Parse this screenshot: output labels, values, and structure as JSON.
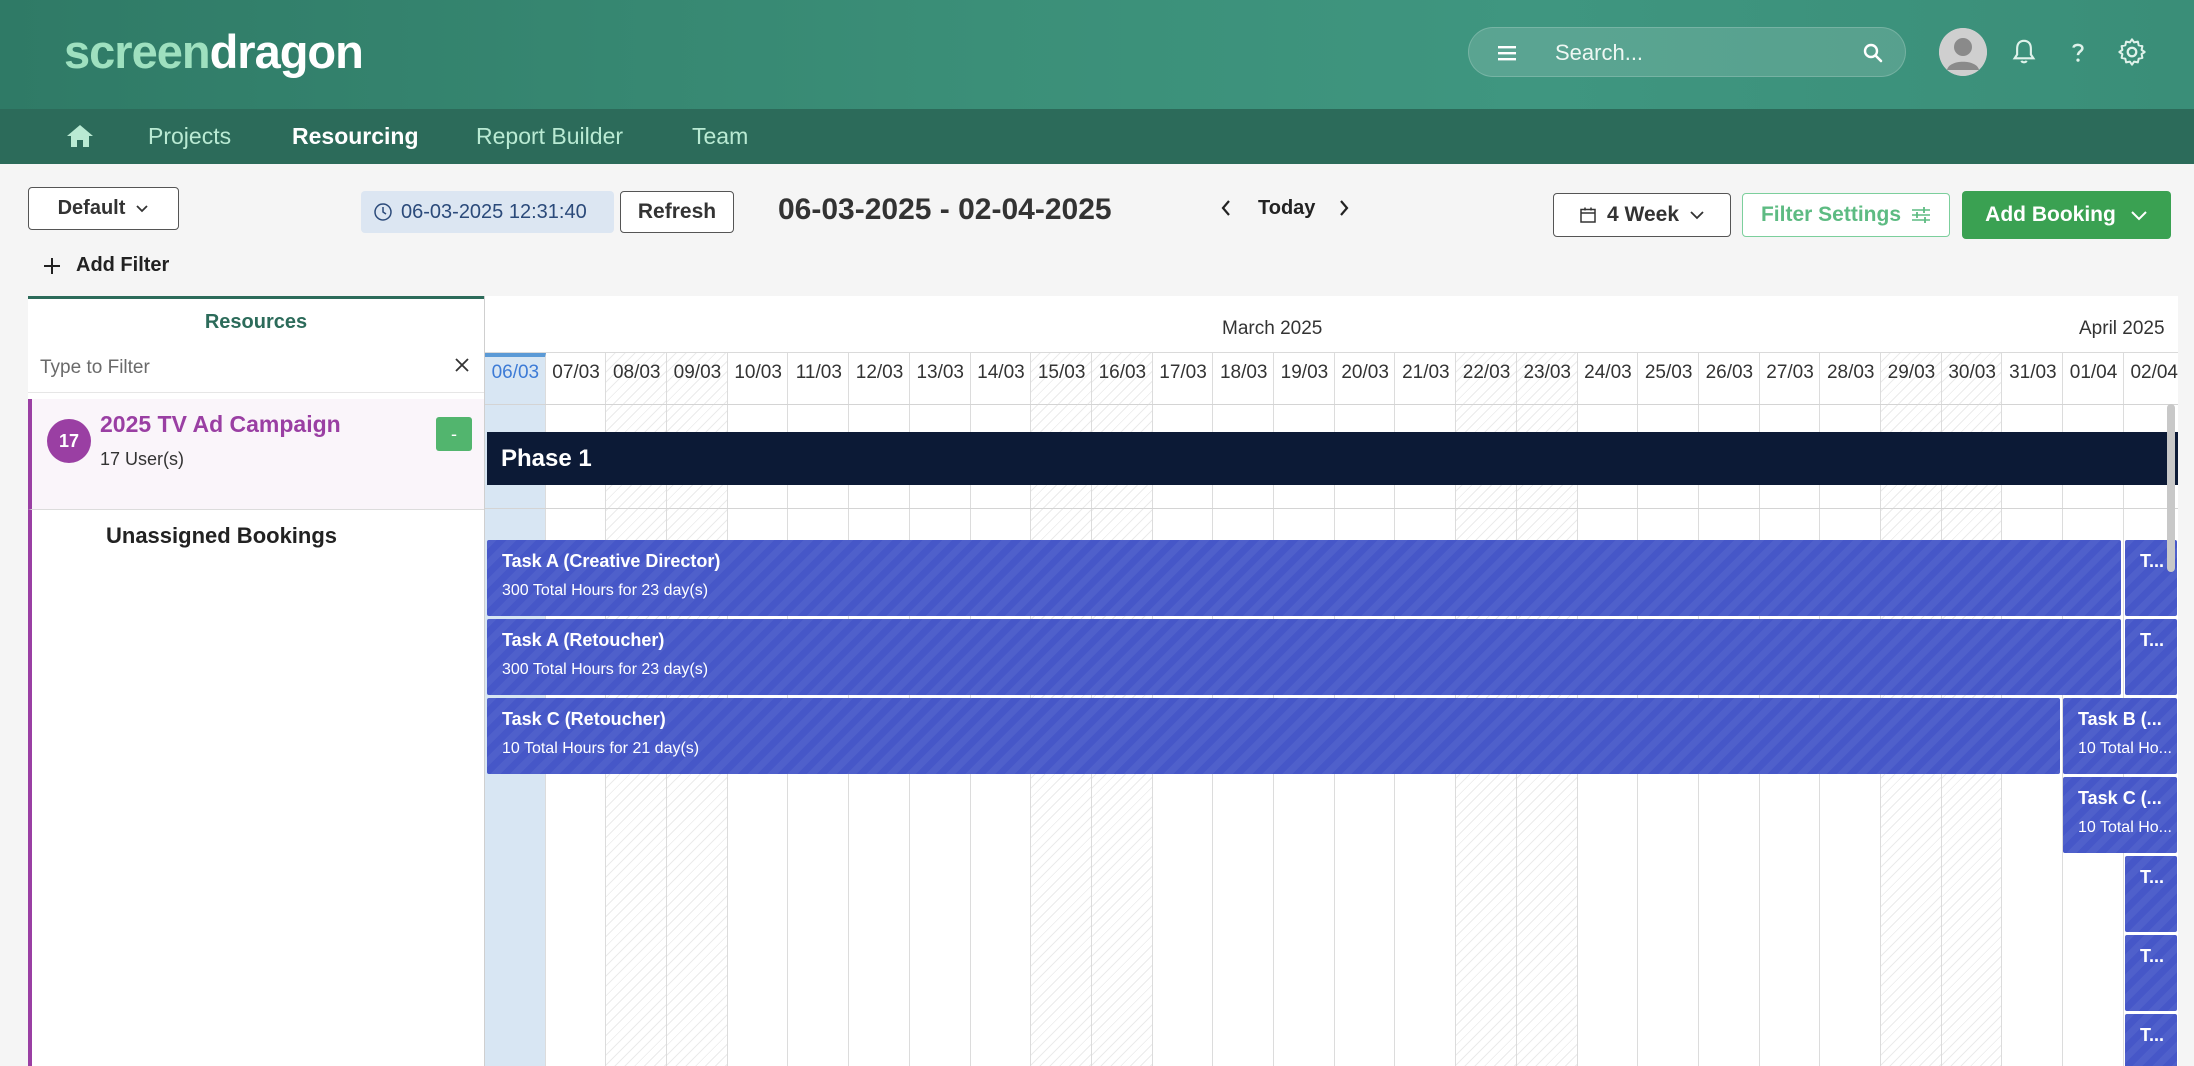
{
  "app": {
    "logo_part1": "screen",
    "logo_part2": "dragon",
    "search_placeholder": "Search..."
  },
  "nav": {
    "items": [
      "Projects",
      "Resourcing",
      "Report Builder",
      "Team"
    ],
    "active": "Resourcing"
  },
  "toolbar": {
    "view_label": "Default",
    "timestamp": "06-03-2025 12:31:40",
    "refresh_label": "Refresh",
    "date_range": "06-03-2025 - 02-04-2025",
    "today_label": "Today",
    "week_label": "4 Week",
    "filter_settings_label": "Filter Settings",
    "add_booking_label": "Add Booking",
    "add_filter_label": "Add Filter"
  },
  "resources": {
    "title": "Resources",
    "filter_placeholder": "Type to Filter",
    "campaign": {
      "badge": "17",
      "name": "2025 TV Ad Campaign",
      "users": "17 User(s)",
      "collapse_label": "-"
    },
    "unassigned_label": "Unassigned Bookings"
  },
  "calendar": {
    "months": [
      "March 2025",
      "April 2025"
    ],
    "days": [
      "06/03",
      "07/03",
      "08/03",
      "09/03",
      "10/03",
      "11/03",
      "12/03",
      "13/03",
      "14/03",
      "15/03",
      "16/03",
      "17/03",
      "18/03",
      "19/03",
      "20/03",
      "21/03",
      "22/03",
      "23/03",
      "24/03",
      "25/03",
      "26/03",
      "27/03",
      "28/03",
      "29/03",
      "30/03",
      "31/03",
      "01/04",
      "02/04"
    ],
    "today_index": 0,
    "weekend_indices": [
      2,
      3,
      9,
      10,
      16,
      17,
      23,
      24
    ],
    "phase_label": "Phase 1",
    "tasks": [
      {
        "name": "Task A (Creative Director)",
        "hours": "300 Total Hours for 23 day(s)"
      },
      {
        "name": "T...",
        "hours": ""
      },
      {
        "name": "Task A (Retoucher)",
        "hours": "300 Total Hours for 23 day(s)"
      },
      {
        "name": "T...",
        "hours": ""
      },
      {
        "name": "Task C (Retoucher)",
        "hours": "10 Total Hours for 21 day(s)"
      },
      {
        "name": "Task B (...",
        "hours": "10 Total Ho..."
      },
      {
        "name": "Task C (...",
        "hours": "10 Total Ho..."
      },
      {
        "name": "T...",
        "hours": ""
      },
      {
        "name": "T...",
        "hours": ""
      },
      {
        "name": "T...",
        "hours": ""
      }
    ]
  },
  "colors": {
    "header": "#3a8e78",
    "nav": "#2c6b5a",
    "campaign": "#9a3fa3",
    "task": "#4657c8",
    "phase": "#0c1a36",
    "add_booking": "#3aa152"
  }
}
